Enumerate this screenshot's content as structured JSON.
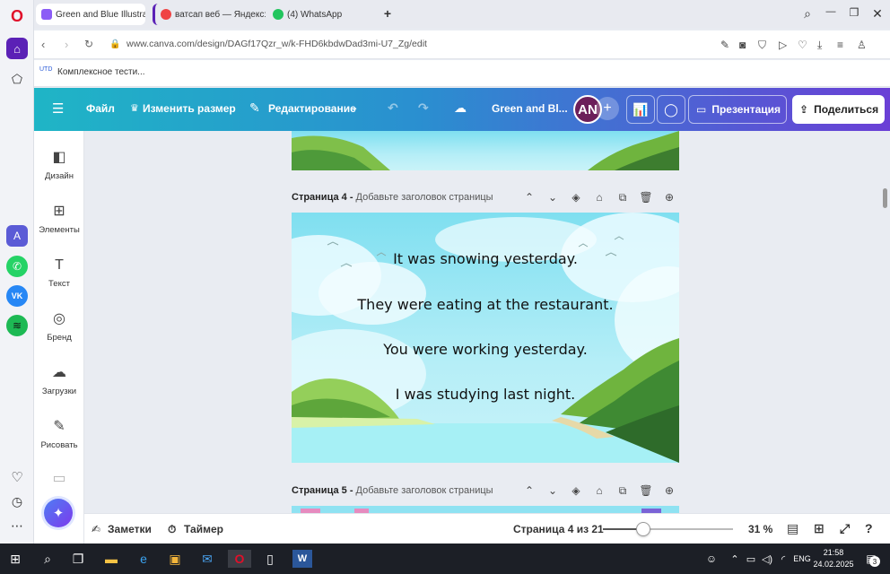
{
  "browser": {
    "tabs": [
      {
        "title": "Green and Blue Illustrative",
        "favicon_color": "#8b5cf6"
      },
      {
        "title": "ватсап веб — Яндекс: на",
        "favicon_color": "#ef4444"
      },
      {
        "title": "(4) WhatsApp",
        "favicon_color": "#22c55e"
      }
    ],
    "new_tab": "+",
    "url": "www.canva.com/design/DAGf17Qzr_w/k-FHD6kbdwDad3mi-U7_Zg/edit",
    "bookmark": "Комплексное тести...",
    "window_controls": {
      "search": "⌕",
      "minimize": "—",
      "restore": "❐",
      "close": "✕"
    }
  },
  "sidebar_icons": [
    "opera-icon",
    "home-icon",
    "pinboard-icon",
    "aria-icon",
    "whatsapp-icon",
    "vk-icon",
    "spotify-icon",
    "heart-icon",
    "history-icon",
    "more-icon"
  ],
  "canva": {
    "toolbar": {
      "menu": "☰",
      "file": "Файл",
      "resize": "Изменить размер",
      "editing": "Редактирование",
      "doc_title": "Green and Bl...",
      "avatar": "AN",
      "present": "Презентация",
      "share": "Поделиться"
    },
    "left_panel": [
      {
        "label": "Дизайн",
        "icon": "◧"
      },
      {
        "label": "Элементы",
        "icon": "⊞"
      },
      {
        "label": "Текст",
        "icon": "T"
      },
      {
        "label": "Бренд",
        "icon": "◎"
      },
      {
        "label": "Загрузки",
        "icon": "☁"
      },
      {
        "label": "Рисовать",
        "icon": "✎"
      }
    ],
    "magic": "✦",
    "page4": {
      "title": "Страница 4 -",
      "subtitle": "Добавьте заголовок страницы",
      "lines": [
        "It was snowing yesterday.",
        "They were eating at the restaurant.",
        "You were working yesterday.",
        "I was studying last night."
      ]
    },
    "page5": {
      "title": "Страница 5 -",
      "subtitle": "Добавьте заголовок страницы"
    },
    "bottom": {
      "notes": "Заметки",
      "timer": "Таймер",
      "page_counter": "Страница 4 из 21",
      "zoom": "31 %",
      "zoom_fraction": 0.31
    }
  },
  "taskbar": {
    "lang": "ENG",
    "time": "21:58",
    "date": "24.02.2025",
    "notifications": "3"
  }
}
